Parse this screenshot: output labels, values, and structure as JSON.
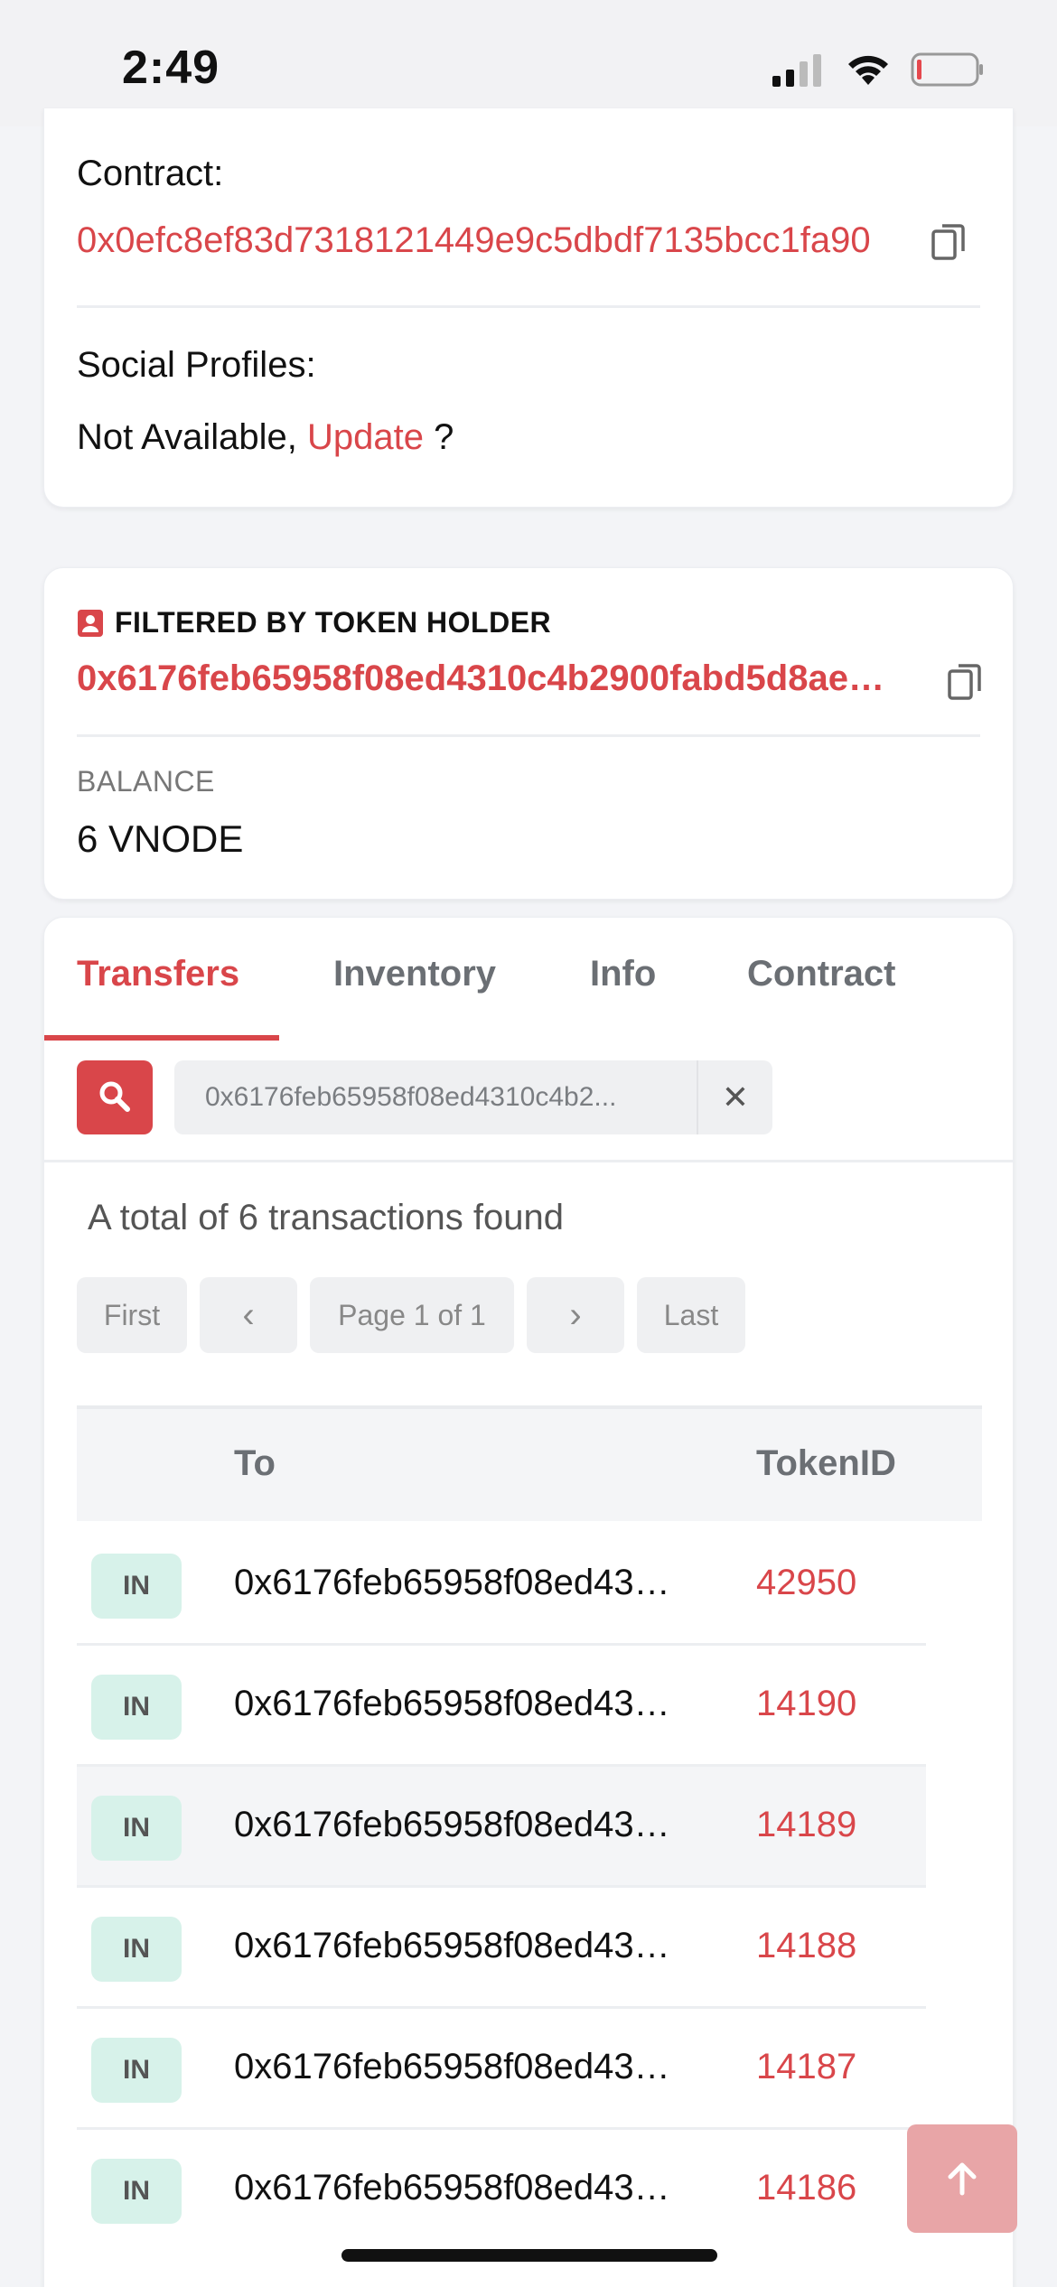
{
  "status_bar": {
    "time": "2:49"
  },
  "token_card": {
    "contract_label": "Contract:",
    "contract_address": "0x0efc8ef83d7318121449e9c5dbdf7135bcc1fa90",
    "social_label": "Social Profiles:",
    "social_value": "Not Available,",
    "social_update_link": "Update",
    "social_suffix": "?"
  },
  "holder_card": {
    "heading": "FILTERED BY TOKEN HOLDER",
    "address": "0x6176feb65958f08ed4310c4b2900fabd5d8ae…",
    "balance_label": "BALANCE",
    "balance_value": "6 VNODE"
  },
  "tabs": [
    {
      "label": "Transfers",
      "active": true
    },
    {
      "label": "Inventory",
      "active": false
    },
    {
      "label": "Info",
      "active": false
    },
    {
      "label": "Contract",
      "active": false
    }
  ],
  "search": {
    "value": "0x6176feb65958f08ed4310c4b2...",
    "clear_icon": "x-icon"
  },
  "results": {
    "total_text": "A total of 6 transactions found"
  },
  "pagination": {
    "first": "First",
    "prev": "‹",
    "page": "Page 1 of 1",
    "next": "›",
    "last": "Last"
  },
  "table": {
    "columns": [
      "To",
      "TokenID"
    ],
    "rows": [
      {
        "direction": "IN",
        "to": "0x6176feb65958f08ed43…",
        "token_id": "42950"
      },
      {
        "direction": "IN",
        "to": "0x6176feb65958f08ed43…",
        "token_id": "14190"
      },
      {
        "direction": "IN",
        "to": "0x6176feb65958f08ed43…",
        "token_id": "14189"
      },
      {
        "direction": "IN",
        "to": "0x6176feb65958f08ed43…",
        "token_id": "14188"
      },
      {
        "direction": "IN",
        "to": "0x6176feb65958f08ed43…",
        "token_id": "14187"
      },
      {
        "direction": "IN",
        "to": "0x6176feb65958f08ed43…",
        "token_id": "14186"
      }
    ]
  },
  "colors": {
    "accent": "#d9464a",
    "badge_bg": "#d7f2ea",
    "fab_bg": "#e8a5a7"
  }
}
